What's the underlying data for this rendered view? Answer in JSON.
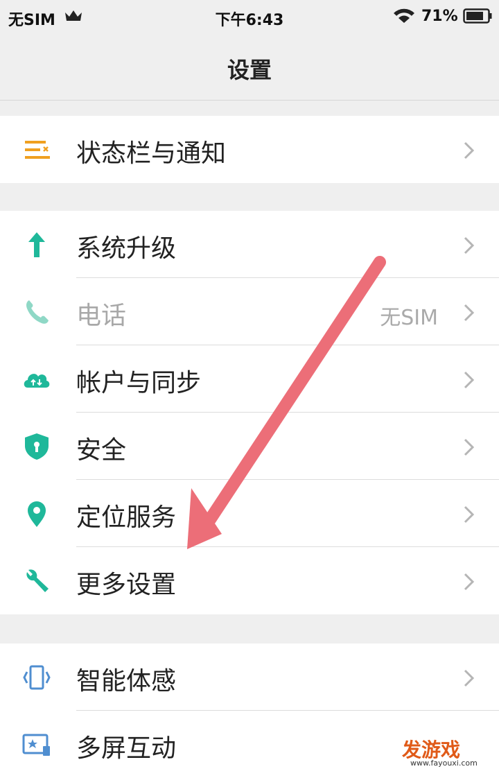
{
  "status_bar": {
    "carrier": "无SIM",
    "time": "下午6:43",
    "battery": "71%"
  },
  "header": {
    "title": "设置"
  },
  "groups": [
    {
      "items": [
        {
          "icon": "status-bar-notification-icon",
          "label": "状态栏与通知",
          "value": ""
        }
      ]
    },
    {
      "items": [
        {
          "icon": "upgrade-arrow-icon",
          "label": "系统升级",
          "value": ""
        },
        {
          "icon": "phone-icon",
          "label": "电话",
          "value": "无SIM",
          "disabled": true
        },
        {
          "icon": "cloud-sync-icon",
          "label": "帐户与同步",
          "value": ""
        },
        {
          "icon": "shield-icon",
          "label": "安全",
          "value": ""
        },
        {
          "icon": "location-pin-icon",
          "label": "定位服务",
          "value": ""
        },
        {
          "icon": "wrench-icon",
          "label": "更多设置",
          "value": ""
        }
      ]
    },
    {
      "items": [
        {
          "icon": "motion-sense-icon",
          "label": "智能体感",
          "value": ""
        },
        {
          "icon": "multi-screen-icon",
          "label": "多屏互动",
          "value": ""
        }
      ]
    }
  ],
  "colors": {
    "accent": "#1fb89a",
    "status_icon": "#f0a020",
    "annotation_arrow": "#ec6e78",
    "chevron": "#b5b5b5"
  },
  "watermark": {
    "text": "发游戏",
    "url": "www.fayouxi.com"
  }
}
